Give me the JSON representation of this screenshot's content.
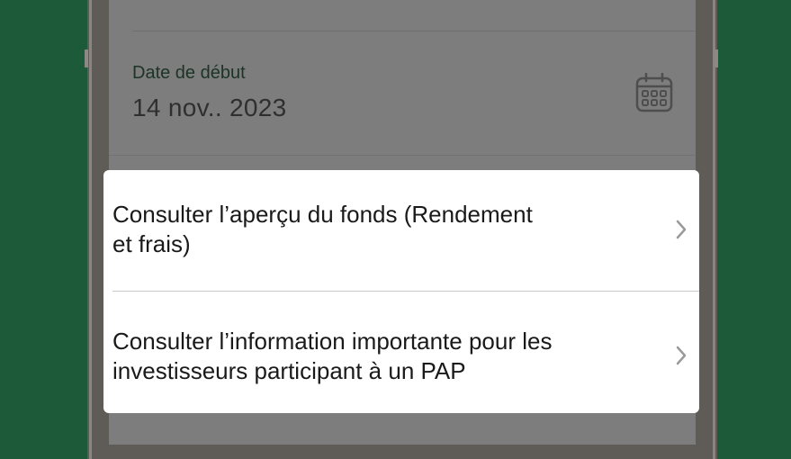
{
  "form": {
    "date_label": "Date de début",
    "date_value": "14 nov.. 2023",
    "calendar_icon": "calendar-icon"
  },
  "sheet": {
    "items": [
      {
        "label_line1": "Consulter l’aperçu du fonds (Rendement",
        "label_line2": "et frais)",
        "icon": "chevron-right-icon"
      },
      {
        "label_line1": "Consulter l’information importante pour les",
        "label_line2": "investisseurs participant à un PAP",
        "icon": "chevron-right-icon"
      }
    ]
  },
  "colors": {
    "background": "#1d5a3a",
    "overlay": "#7d7d7d",
    "sheet": "#ffffff",
    "text": "#1a1a1a",
    "chevron": "#9a9a9a"
  }
}
